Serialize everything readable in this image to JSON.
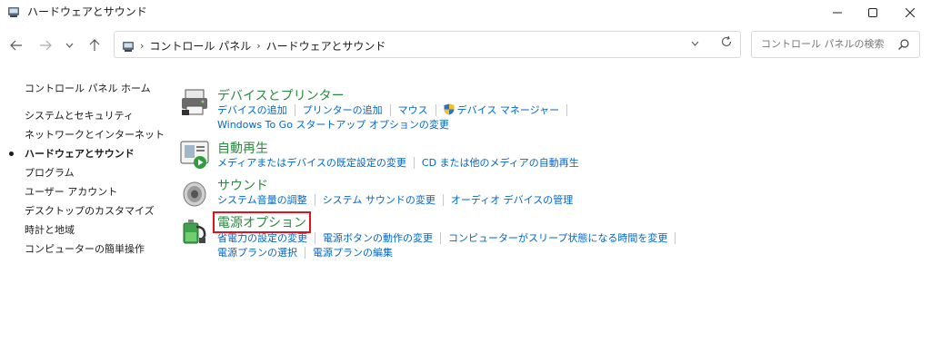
{
  "window": {
    "title": "ハードウェアとサウンド",
    "icon": "control-panel-icon"
  },
  "address": {
    "breadcrumbs": [
      "コントロール パネル",
      "ハードウェアとサウンド"
    ]
  },
  "search": {
    "placeholder": "コントロール パネルの検索"
  },
  "sidebar": {
    "items": [
      {
        "label": "コントロール パネル ホーム"
      },
      {
        "label": "システムとセキュリティ"
      },
      {
        "label": "ネットワークとインターネット"
      },
      {
        "label": "ハードウェアとサウンド",
        "current": true
      },
      {
        "label": "プログラム"
      },
      {
        "label": "ユーザー アカウント"
      },
      {
        "label": "デスクトップのカスタマイズ"
      },
      {
        "label": "時計と地域"
      },
      {
        "label": "コンピューターの簡単操作"
      }
    ]
  },
  "categories": [
    {
      "title": "デバイスとプリンター",
      "icon": "devices-printers-icon",
      "links_row1": [
        "デバイスの追加",
        "プリンターの追加",
        "マウス",
        "デバイス マネージャー"
      ],
      "links_row2": [
        "Windows To Go スタートアップ オプションの変更"
      ]
    },
    {
      "title": "自動再生",
      "icon": "autoplay-icon",
      "links_row1": [
        "メディアまたはデバイスの既定設定の変更",
        "CD または他のメディアの自動再生"
      ]
    },
    {
      "title": "サウンド",
      "icon": "sound-speaker-icon",
      "links_row1": [
        "システム音量の調整",
        "システム サウンドの変更",
        "オーディオ デバイスの管理"
      ]
    },
    {
      "title": "電源オプション",
      "icon": "power-options-icon",
      "highlighted": true,
      "links_row1": [
        "省電力の設定の変更",
        "電源ボタンの動作の変更",
        "コンピューターがスリープ状態になる時間を変更"
      ],
      "links_row2": [
        "電源プランの選択",
        "電源プランの編集"
      ]
    }
  ],
  "colors": {
    "category_title": "#2a8a3e",
    "link": "#0066cc",
    "highlight_border": "#e0131d"
  }
}
